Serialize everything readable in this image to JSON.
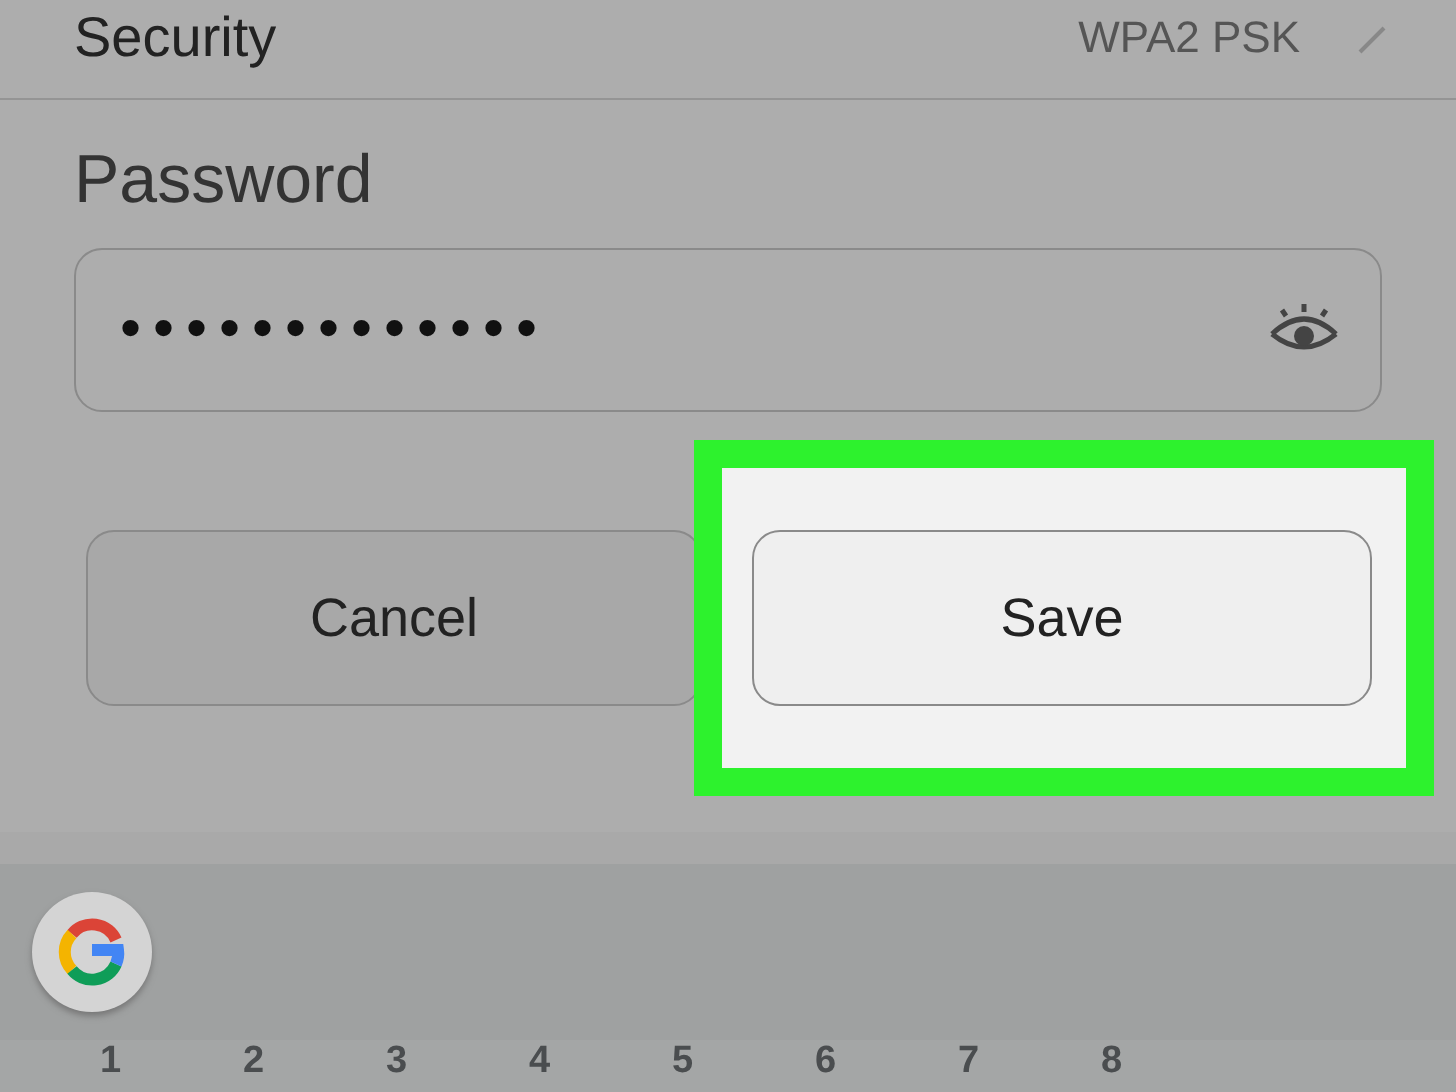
{
  "security": {
    "label": "Security",
    "value": "WPA2 PSK"
  },
  "password": {
    "label": "Password",
    "value": "•••••••••••••"
  },
  "buttons": [
    {
      "label": "Cancel",
      "highlighted": false
    },
    {
      "label": "Save",
      "highlighted": true
    }
  ],
  "keyboard": {
    "number_keys": [
      "1",
      "2",
      "3",
      "4",
      "5",
      "6",
      "7",
      "8"
    ]
  }
}
